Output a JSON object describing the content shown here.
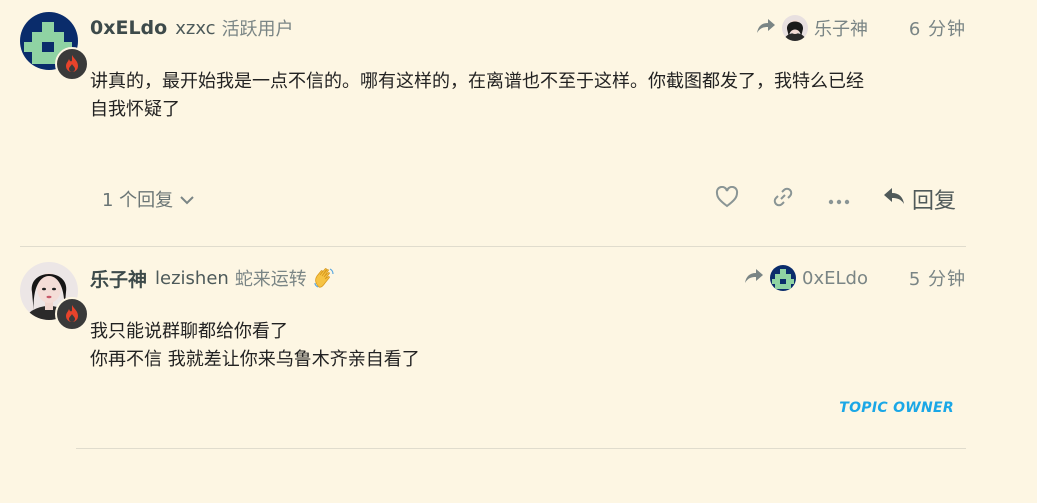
{
  "posts": [
    {
      "username": "0xELdo",
      "full_name": "xzxc",
      "user_title": "活跃用户",
      "reply_to_user": "乐子神",
      "date": "6 分钟",
      "body_lines": [
        "讲真的，最开始我是一点不信的。哪有这样的，在离谱也不至于这样。你截图都发了，我特么已经",
        "自我怀疑了"
      ],
      "replies_label": "1 个回复",
      "reply_button": "回复",
      "icons": [
        "share-icon",
        "heart-icon",
        "link-icon",
        "more-icon",
        "reply-icon",
        "chevron-down-icon",
        "fire-icon"
      ]
    },
    {
      "username": "乐子神",
      "full_name": "lezishen",
      "user_title": "蛇来运转",
      "reply_to_user": "0xELdo",
      "date": "5 分钟",
      "body_lines": [
        "我只能说群聊都给你看了",
        "你再不信 我就差让你来乌鲁木齐亲自看了"
      ],
      "badge": "TOPIC OWNER",
      "icons": [
        "share-icon",
        "waving-hand-icon",
        "fire-icon"
      ]
    }
  ],
  "colors": {
    "background": "#fdf6e3",
    "text": "#222222",
    "muted": "#7a8585",
    "accent_badge": "#1aa7e6"
  }
}
